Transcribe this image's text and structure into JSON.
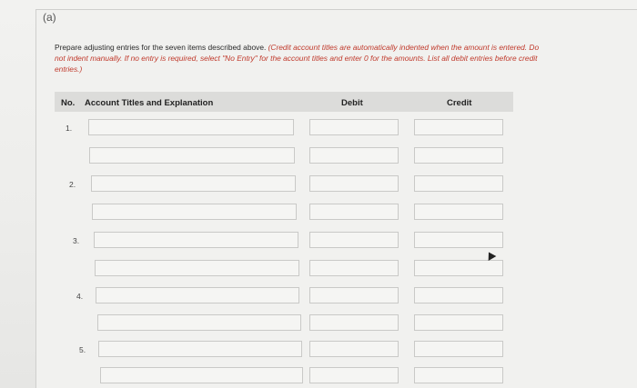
{
  "part_label": "(a)",
  "instructions": {
    "plain": "Prepare adjusting entries for the seven items described above. ",
    "red": "(Credit account titles are automatically indented when the amount is entered. Do not indent manually. If no entry is required, select \"No Entry\" for the account titles and enter 0 for the amounts. List all debit entries before credit entries.)"
  },
  "table": {
    "headers": {
      "no": "No.",
      "account": "Account Titles and Explanation",
      "debit": "Debit",
      "credit": "Credit"
    },
    "rows": [
      {
        "no": "1."
      },
      {
        "no": ""
      },
      {
        "no": "2."
      },
      {
        "no": ""
      },
      {
        "no": "3."
      },
      {
        "no": ""
      },
      {
        "no": "4."
      },
      {
        "no": ""
      },
      {
        "no": "5."
      },
      {
        "no": ""
      }
    ]
  }
}
